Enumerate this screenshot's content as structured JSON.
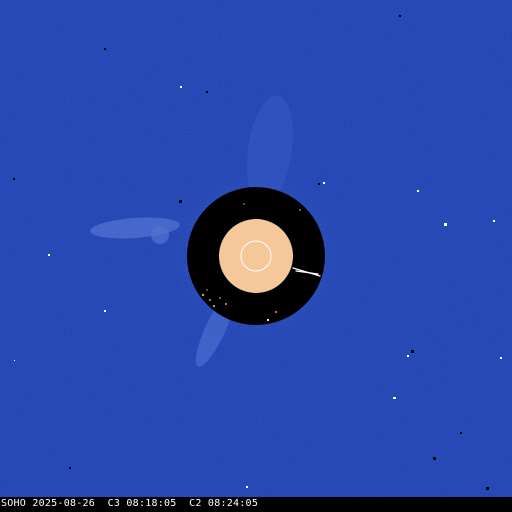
{
  "image": {
    "caption": "SOHO 2025-08-26  C3 08:18:05  C2 08:24:05"
  },
  "colors": {
    "background_blue": "#1d3db0",
    "occulter_black": "#000000",
    "sun_disk": "#f5c79a",
    "sun_outline": "#ffffff",
    "caption_text": "#ffffff",
    "caption_bar": "#000000"
  }
}
